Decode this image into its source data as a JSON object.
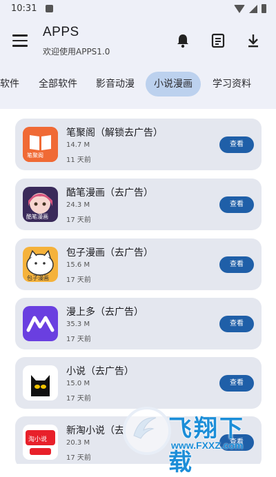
{
  "status_bar": {
    "time": "10:31"
  },
  "app_bar": {
    "title": "APPS",
    "subtitle": "欢迎使用APPS1.0"
  },
  "tabs": [
    {
      "label": "软件"
    },
    {
      "label": "全部软件"
    },
    {
      "label": "影音动漫"
    },
    {
      "label": "小说漫画",
      "active": true
    },
    {
      "label": "学习资料"
    }
  ],
  "apps": [
    {
      "name": "笔聚阁（解锁去广告）",
      "size": "14.7 M",
      "date": "11 天前",
      "button": "查看",
      "icon_label": "笔聚阁",
      "icon": "book-icon"
    },
    {
      "name": "酷笔漫画（去广告）",
      "size": "24.3 M",
      "date": "17 天前",
      "button": "查看",
      "icon_label": "酷笔漫画",
      "icon": "anime-girl-icon"
    },
    {
      "name": "包子漫画（去广告）",
      "size": "15.6 M",
      "date": "17 天前",
      "button": "查看",
      "icon_label": "包子漫画",
      "icon": "bun-cat-icon"
    },
    {
      "name": "漫上多（去广告）",
      "size": "35.3 M",
      "date": "17 天前",
      "button": "查看",
      "icon_label": "",
      "icon": "ma-logo-icon"
    },
    {
      "name": "小说（去广告）",
      "size": "15.0 M",
      "date": "17 天前",
      "button": "查看",
      "icon_label": "",
      "icon": "black-cat-icon"
    },
    {
      "name": "新淘小说（去",
      "size": "20.3 M",
      "date": "17 天前",
      "button": "查看",
      "icon_label": "淘小说",
      "icon": "tao-novel-icon"
    }
  ],
  "watermark": {
    "text": "飞翔下载",
    "url": "www.FXXZ.com"
  }
}
